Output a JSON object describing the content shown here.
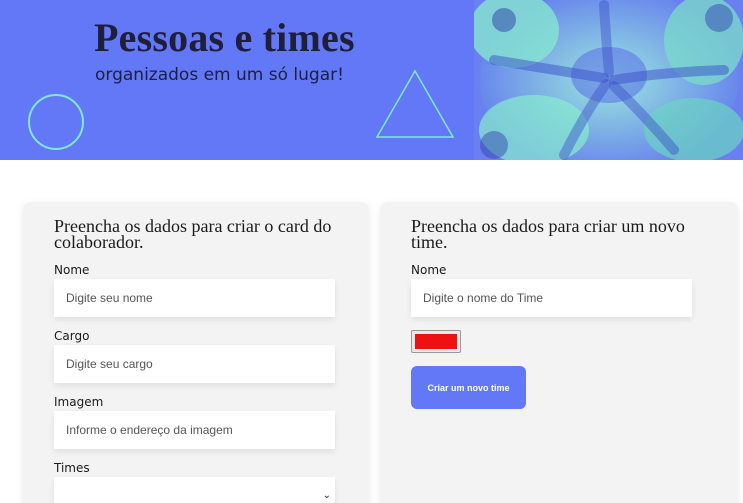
{
  "banner": {
    "title": "Pessoas e times",
    "subtitle": "organizados em um só lugar!",
    "background_color": "#6278f7",
    "accent_color": "#7ee8d4"
  },
  "collaborator_form": {
    "heading": "Preencha os dados para criar o card do colaborador.",
    "name_label": "Nome",
    "name_placeholder": "Digite seu nome",
    "role_label": "Cargo",
    "role_placeholder": "Digite seu cargo",
    "image_label": "Imagem",
    "image_placeholder": "Informe o endereço da imagem",
    "teams_label": "Times",
    "teams_selected": ""
  },
  "team_form": {
    "heading": "Preencha os dados para criar um novo time.",
    "name_label": "Nome",
    "name_placeholder": "Digite o nome do Time",
    "color_value": "#ee1111",
    "button_label": "Criar um novo time"
  }
}
